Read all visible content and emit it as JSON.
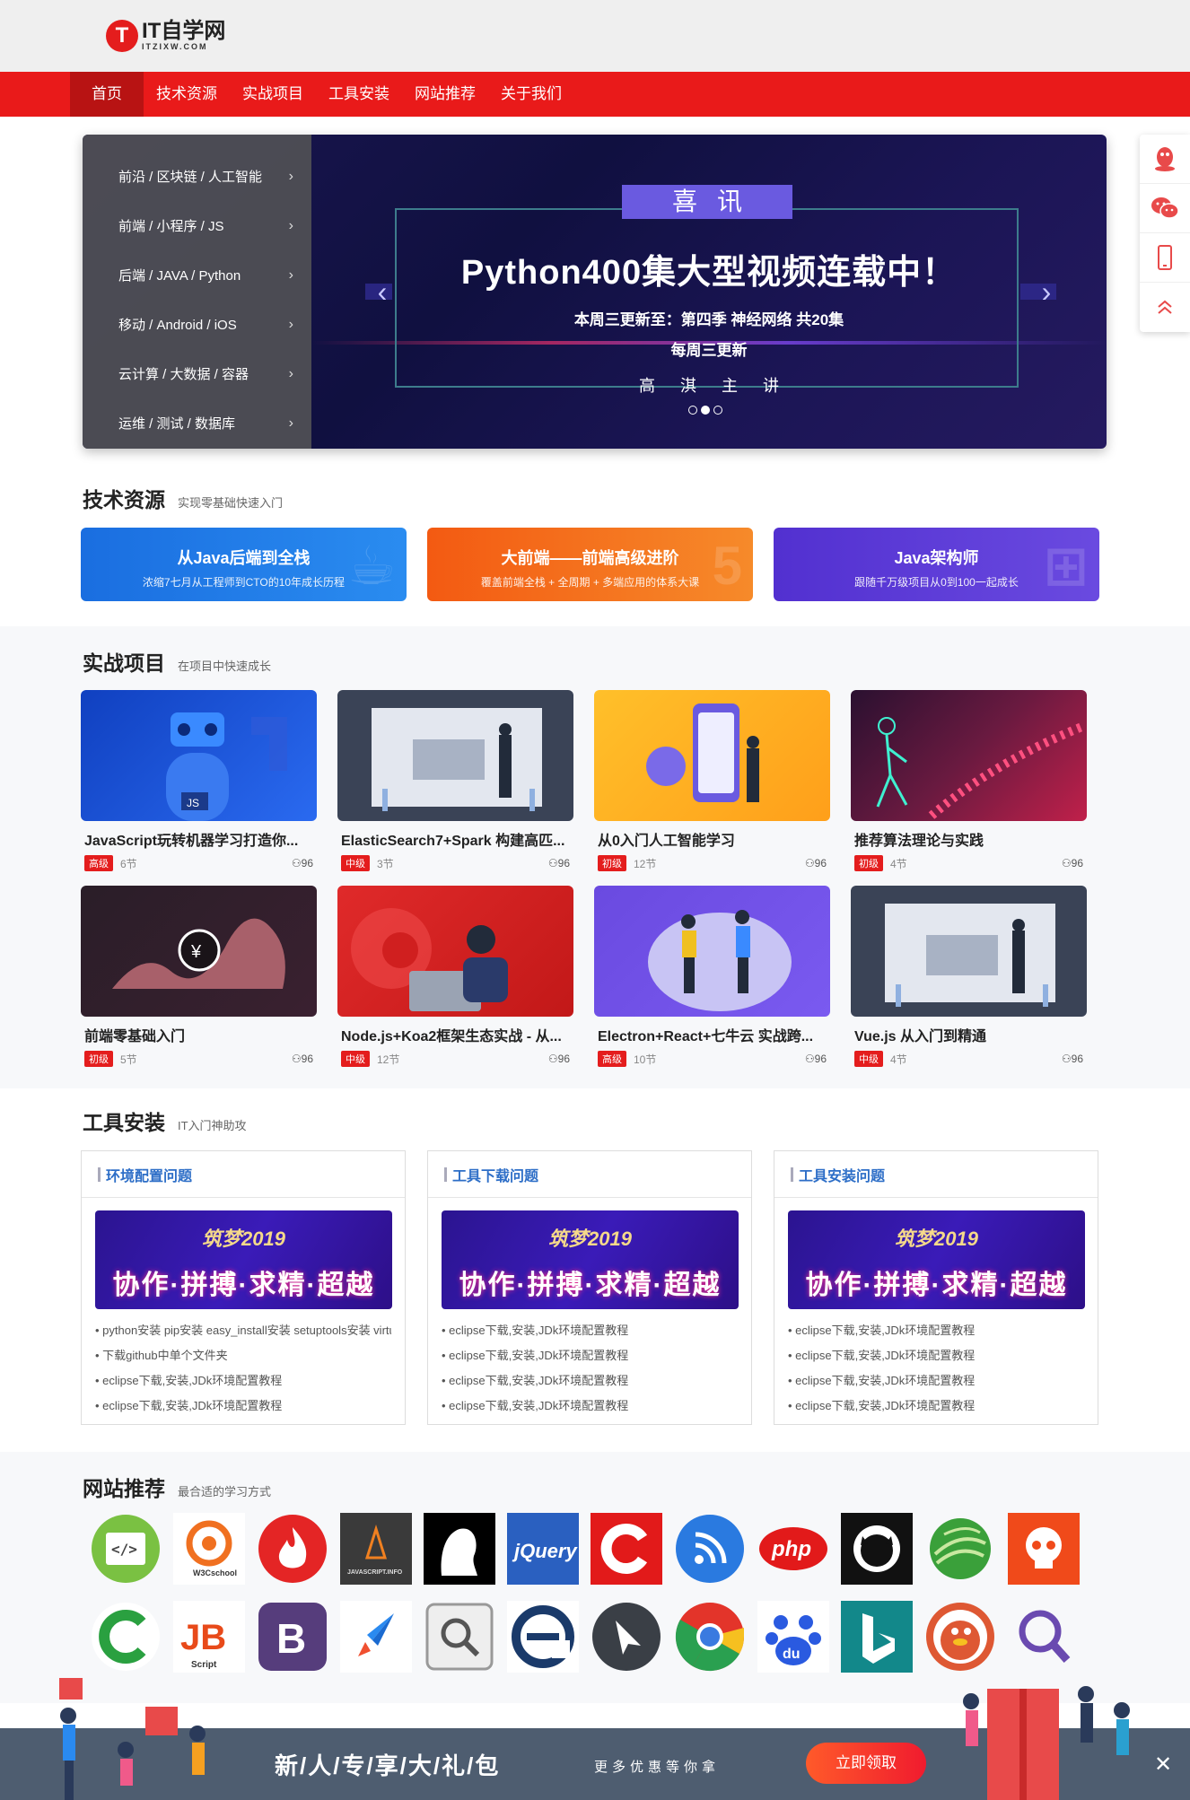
{
  "header": {
    "logo_mark": "T",
    "logo_cn": "IT自学网",
    "logo_en": "ITZIXW.COM"
  },
  "nav": [
    "首页",
    "技术资源",
    "实战项目",
    "工具安装",
    "网站推荐",
    "关于我们"
  ],
  "side_menu": [
    "前沿 / 区块链 / 人工智能",
    "前端 / 小程序 / JS",
    "后端 / JAVA / Python",
    "移动 / Android / iOS",
    "云计算 / 大数据 / 容器",
    "运维 / 测试 / 数据库"
  ],
  "banner": {
    "badge": "喜讯",
    "title": "Python400集大型视频连载中！",
    "line1": "本周三更新至：第四季 神经网络  共20集",
    "line2": "每周三更新",
    "line3": "高淇主讲",
    "prev": "‹",
    "next": "›"
  },
  "sections": {
    "tech": {
      "title": "技术资源",
      "sub": "实现零基础快速入门"
    },
    "projects": {
      "title": "实战项目",
      "sub": "在项目中快速成长"
    },
    "tools": {
      "title": "工具安装",
      "sub": "IT入门神助攻"
    },
    "sites": {
      "title": "网站推荐",
      "sub": "最合适的学习方式"
    }
  },
  "resources": [
    {
      "title": "从Java后端到全栈",
      "sub": "浓缩7七月从工程师到CTO的10年成长历程",
      "deco": "☕",
      "color": "#1f76e0"
    },
    {
      "title": "大前端——前端高级进阶",
      "sub": "覆盖前端全栈 + 全周期 + 多端应用的体系大课",
      "deco": "5",
      "color": "#f0601a"
    },
    {
      "title": "Java架构师",
      "sub": "跟随千万级项目从0到100一起成长",
      "deco": "⊞",
      "color": "#5a3ed8"
    }
  ],
  "projects": [
    {
      "title": "JavaScript玩转机器学习打造你...",
      "level": "高级",
      "lessons": "6节",
      "users": "96"
    },
    {
      "title": "ElasticSearch7+Spark 构建高匹...",
      "level": "中级",
      "lessons": "3节",
      "users": "96"
    },
    {
      "title": "从0入门人工智能学习",
      "level": "初级",
      "lessons": "12节",
      "users": "96"
    },
    {
      "title": "推荐算法理论与实践",
      "level": "初级",
      "lessons": "4节",
      "users": "96"
    },
    {
      "title": "前端零基础入门",
      "level": "初级",
      "lessons": "5节",
      "users": "96"
    },
    {
      "title": "Node.js+Koa2框架生态实战 - 从...",
      "level": "中级",
      "lessons": "12节",
      "users": "96"
    },
    {
      "title": "Electron+React+七牛云 实战跨...",
      "level": "高级",
      "lessons": "10节",
      "users": "96"
    },
    {
      "title": "Vue.js 从入门到精通",
      "level": "中级",
      "lessons": "4节",
      "users": "96"
    }
  ],
  "tools": [
    {
      "title": "环境配置问题",
      "items": [
        "python安装 pip安装 easy_install安装 setuptools安装 virtualenv",
        "下载github中单个文件夹",
        "eclipse下载,安装,JDk环境配置教程",
        "eclipse下载,安装,JDk环境配置教程"
      ]
    },
    {
      "title": "工具下载问题",
      "items": [
        "eclipse下载,安装,JDk环境配置教程",
        "eclipse下载,安装,JDk环境配置教程",
        "eclipse下载,安装,JDk环境配置教程",
        "eclipse下载,安装,JDk环境配置教程"
      ]
    },
    {
      "title": "工具安装问题",
      "items": [
        "eclipse下载,安装,JDk环境配置教程",
        "eclipse下载,安装,JDk环境配置教程",
        "eclipse下载,安装,JDk环境配置教程",
        "eclipse下载,安装,JDk环境配置教程"
      ]
    }
  ],
  "tool_banner": {
    "year": "筑梦2019",
    "motto": "协作·拼搏·求精·超越"
  },
  "sites": [
    {
      "name": "code-icon",
      "glyph": "</>"
    },
    {
      "name": "w3cschool-icon",
      "glyph": "W3C"
    },
    {
      "name": "codepen-flame-icon",
      "glyph": "🔥"
    },
    {
      "name": "javascript-info-icon",
      "glyph": "JS"
    },
    {
      "name": "silhouette-icon",
      "glyph": "☗"
    },
    {
      "name": "jquery-icon",
      "glyph": "jQuery"
    },
    {
      "name": "c-logo-icon",
      "glyph": "C"
    },
    {
      "name": "rss-icon",
      "glyph": "◉"
    },
    {
      "name": "php-icon",
      "glyph": "php"
    },
    {
      "name": "github-icon",
      "glyph": "🐱"
    },
    {
      "name": "globe-icon",
      "glyph": "◍"
    },
    {
      "name": "skull-icon",
      "glyph": "☠"
    },
    {
      "name": "codecademy-icon",
      "glyph": "C"
    },
    {
      "name": "jbscript-icon",
      "glyph": "JB"
    },
    {
      "name": "bootstrap-icon",
      "glyph": "B"
    },
    {
      "name": "rocket-icon",
      "glyph": "🚀"
    },
    {
      "name": "magnifier-box-icon",
      "glyph": "🔍"
    },
    {
      "name": "ie-e-icon",
      "glyph": "e"
    },
    {
      "name": "cursor-circle-icon",
      "glyph": "◣"
    },
    {
      "name": "chrome-icon",
      "glyph": "◎"
    },
    {
      "name": "baidu-icon",
      "glyph": "du"
    },
    {
      "name": "bing-icon",
      "glyph": "b"
    },
    {
      "name": "duckduckgo-icon",
      "glyph": "🦆"
    },
    {
      "name": "search-icon",
      "glyph": "⚲"
    }
  ],
  "promo": {
    "title": "新/人/专/享/大/礼/包",
    "sub": "更多优惠等你拿",
    "button": "立即领取",
    "close": "✕"
  },
  "float_bar": [
    "qq-icon",
    "wechat-icon",
    "mobile-icon",
    "back-to-top-icon"
  ]
}
